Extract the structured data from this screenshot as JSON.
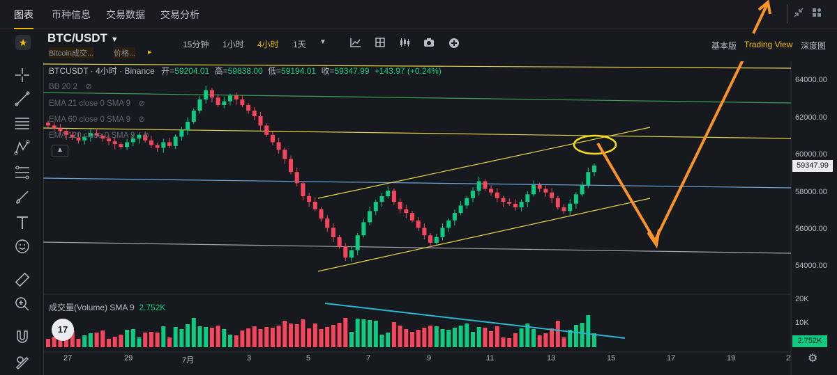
{
  "nav": {
    "tabs": [
      "图表",
      "币种信息",
      "交易数据",
      "交易分析"
    ]
  },
  "symbol": {
    "name": "BTC/USDT",
    "sub1": "Bitcoin成交...",
    "sub2": "价格..."
  },
  "timeframes": [
    "15分钟",
    "1小时",
    "4小时",
    "1天"
  ],
  "active_timeframe": "4小时",
  "views": [
    "基本版",
    "Trading View",
    "深度图"
  ],
  "active_view": "Trading View",
  "legend": {
    "title": "BTCUSDT · 4小时 · Binance",
    "open_label": "开=",
    "open": "59204.01",
    "high_label": "高=",
    "high": "59838.00",
    "low_label": "低=",
    "low": "59194.01",
    "close_label": "收=",
    "close": "59347.99",
    "change": "+143.97 (+0.24%)"
  },
  "indicators": [
    "BB 20 2",
    "EMA 21 close 0 SMA 9",
    "EMA 60 close 0 SMA 9",
    "EMA 120 close 0 SMA 9"
  ],
  "price_axis": [
    "64000.00",
    "62000.00",
    "60000.00",
    "58000.00",
    "56000.00",
    "54000.00"
  ],
  "current_price": "59347.99",
  "volume": {
    "label": "成交量(Volume) SMA 9",
    "value": "2.752K",
    "axis": [
      "20K",
      "10K"
    ],
    "current": "2.752K"
  },
  "dates": [
    "27",
    "29",
    "7月",
    "3",
    "5",
    "7",
    "9",
    "11",
    "13",
    "15",
    "17",
    "19",
    "2"
  ],
  "colors": {
    "up": "#0ecb81",
    "down": "#f6465d",
    "accent": "#f0b90b",
    "arrow": "#f7932a"
  },
  "chart_data": {
    "type": "candlestick",
    "unit": "USDT",
    "ylim": [
      53000,
      65500
    ],
    "closes": [
      61500,
      61350,
      61200,
      61000,
      60850,
      60700,
      60900,
      61100,
      60950,
      60800,
      60650,
      60500,
      60350,
      60600,
      60800,
      61000,
      60700,
      60450,
      60300,
      60600,
      60400,
      60900,
      61250,
      61700,
      62300,
      62900,
      63400,
      63000,
      62600,
      62800,
      63100,
      62900,
      62600,
      62300,
      62000,
      61500,
      61000,
      60600,
      60200,
      59700,
      59000,
      58400,
      57700,
      57400,
      57000,
      56500,
      56000,
      55500,
      55000,
      54400,
      54800,
      55600,
      56300,
      56900,
      57400,
      57700,
      58000,
      57400,
      57000,
      56800,
      56400,
      56000,
      55600,
      55200,
      55500,
      56000,
      56400,
      56800,
      57200,
      57600,
      58000,
      58500,
      58100,
      57900,
      57600,
      57400,
      57300,
      57100,
      57400,
      57800,
      58300,
      58100,
      57900,
      57600,
      57100,
      56900,
      57300,
      57800,
      58300,
      59000,
      59348
    ]
  }
}
